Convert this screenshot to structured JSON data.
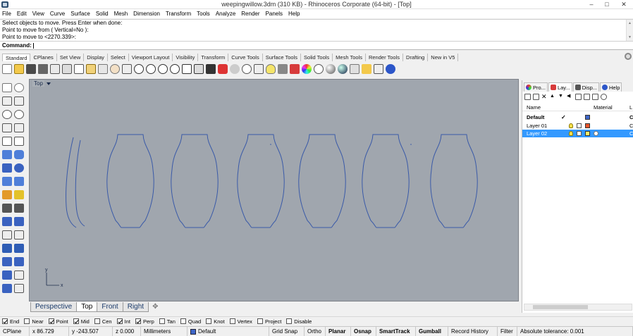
{
  "window": {
    "title": "weepingwillow.3dm (310 KB) - Rhinoceros Corporate (64-bit) - [Top]",
    "close_label": "✕",
    "minimize_label": "–",
    "maximize_label": "□"
  },
  "menu": [
    "File",
    "Edit",
    "View",
    "Curve",
    "Surface",
    "Solid",
    "Mesh",
    "Dimension",
    "Transform",
    "Tools",
    "Analyze",
    "Render",
    "Panels",
    "Help"
  ],
  "command_history": [
    "Select objects to move. Press Enter when done:",
    "Point to move from ( Vertical=No ):",
    "Point to move to <2270.339>:"
  ],
  "command_prompt": "Command:",
  "toolbar_tabs": [
    "Standard",
    "CPlanes",
    "Set View",
    "Display",
    "Select",
    "Viewport Layout",
    "Visibility",
    "Transform",
    "Curve Tools",
    "Surface Tools",
    "Solid Tools",
    "Mesh Tools",
    "Render Tools",
    "Drafting",
    "New in V5"
  ],
  "active_toolbar_tab": "Standard",
  "viewport": {
    "label": "Top",
    "axis_y": "y",
    "axis_x": "x",
    "background_color": "#a0a6ae",
    "curve_color": "#3a5aa8"
  },
  "viewport_tabs": [
    "Perspective",
    "Top",
    "Front",
    "Right"
  ],
  "active_viewport_tab": "Top",
  "viewport_add_label": "✥",
  "panel": {
    "tabs": [
      "Pro...",
      "Lay...",
      "Disp...",
      "Help"
    ],
    "active_tab": "Lay...",
    "columns": {
      "name": "Name",
      "material": "Material",
      "extra": "L"
    },
    "layers": [
      {
        "name": "Default",
        "current_mark": "✓",
        "color": "#3f67c9",
        "extra": "C",
        "bold": true,
        "selected": false
      },
      {
        "name": "Layer 01",
        "current_mark": "",
        "color": "#e8542a",
        "extra": "C",
        "bold": false,
        "selected": false
      },
      {
        "name": "Layer 02",
        "current_mark": "",
        "color": "#f6ef6a",
        "extra": "C",
        "bold": false,
        "selected": true
      }
    ]
  },
  "osnap": [
    {
      "label": "End",
      "checked": true
    },
    {
      "label": "Near",
      "checked": false
    },
    {
      "label": "Point",
      "checked": true
    },
    {
      "label": "Mid",
      "checked": true
    },
    {
      "label": "Cen",
      "checked": false
    },
    {
      "label": "Int",
      "checked": true
    },
    {
      "label": "Perp",
      "checked": true
    },
    {
      "label": "Tan",
      "checked": false
    },
    {
      "label": "Quad",
      "checked": false
    },
    {
      "label": "Knot",
      "checked": false
    },
    {
      "label": "Vertex",
      "checked": false
    },
    {
      "label": "Project",
      "checked": false
    },
    {
      "label": "Disable",
      "checked": false
    }
  ],
  "status": {
    "cplane": "CPlane",
    "x": "x 86.729",
    "y": "y -243.507",
    "z": "z 0.000",
    "units": "Millimeters",
    "layer": "Default",
    "layer_color": "#3f67c9",
    "grid_snap": "Grid Snap",
    "ortho": "Ortho",
    "planar": "Planar",
    "osnap": "Osnap",
    "smarttrack": "SmartTrack",
    "gumball": "Gumball",
    "record_history": "Record History",
    "filter": "Filter",
    "tolerance": "Absolute tolerance: 0.001"
  }
}
